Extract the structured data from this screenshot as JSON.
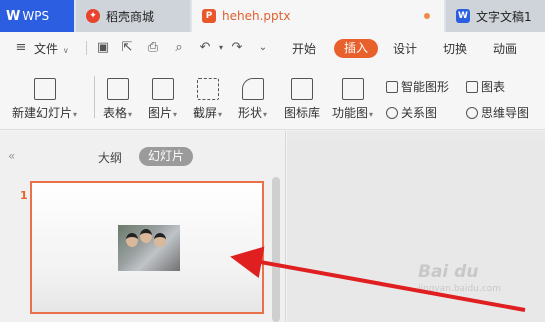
{
  "tabs": {
    "wps": "WPS",
    "daoke": "稻壳商城",
    "pptx": "heheh.pptx",
    "doc": "文字文稿1"
  },
  "menu": {
    "file": "文件",
    "start": "开始",
    "insert": "插入",
    "design": "设计",
    "switch": "切换",
    "animation": "动画"
  },
  "ribbon": {
    "new_slide": "新建幻灯片",
    "table": "表格",
    "picture": "图片",
    "screenshot": "截屏",
    "shape": "形状",
    "icon_library": "图标库",
    "function_chart": "功能图",
    "smart_graphic": "智能图形",
    "chart": "图表",
    "relation_chart": "关系图",
    "mind_map": "思维导图"
  },
  "panel": {
    "outline": "大纲",
    "slides": "幻灯片",
    "slide_number": "1"
  },
  "watermark": {
    "brand": "Bai du",
    "sub": "jingyan.baidu.com"
  }
}
